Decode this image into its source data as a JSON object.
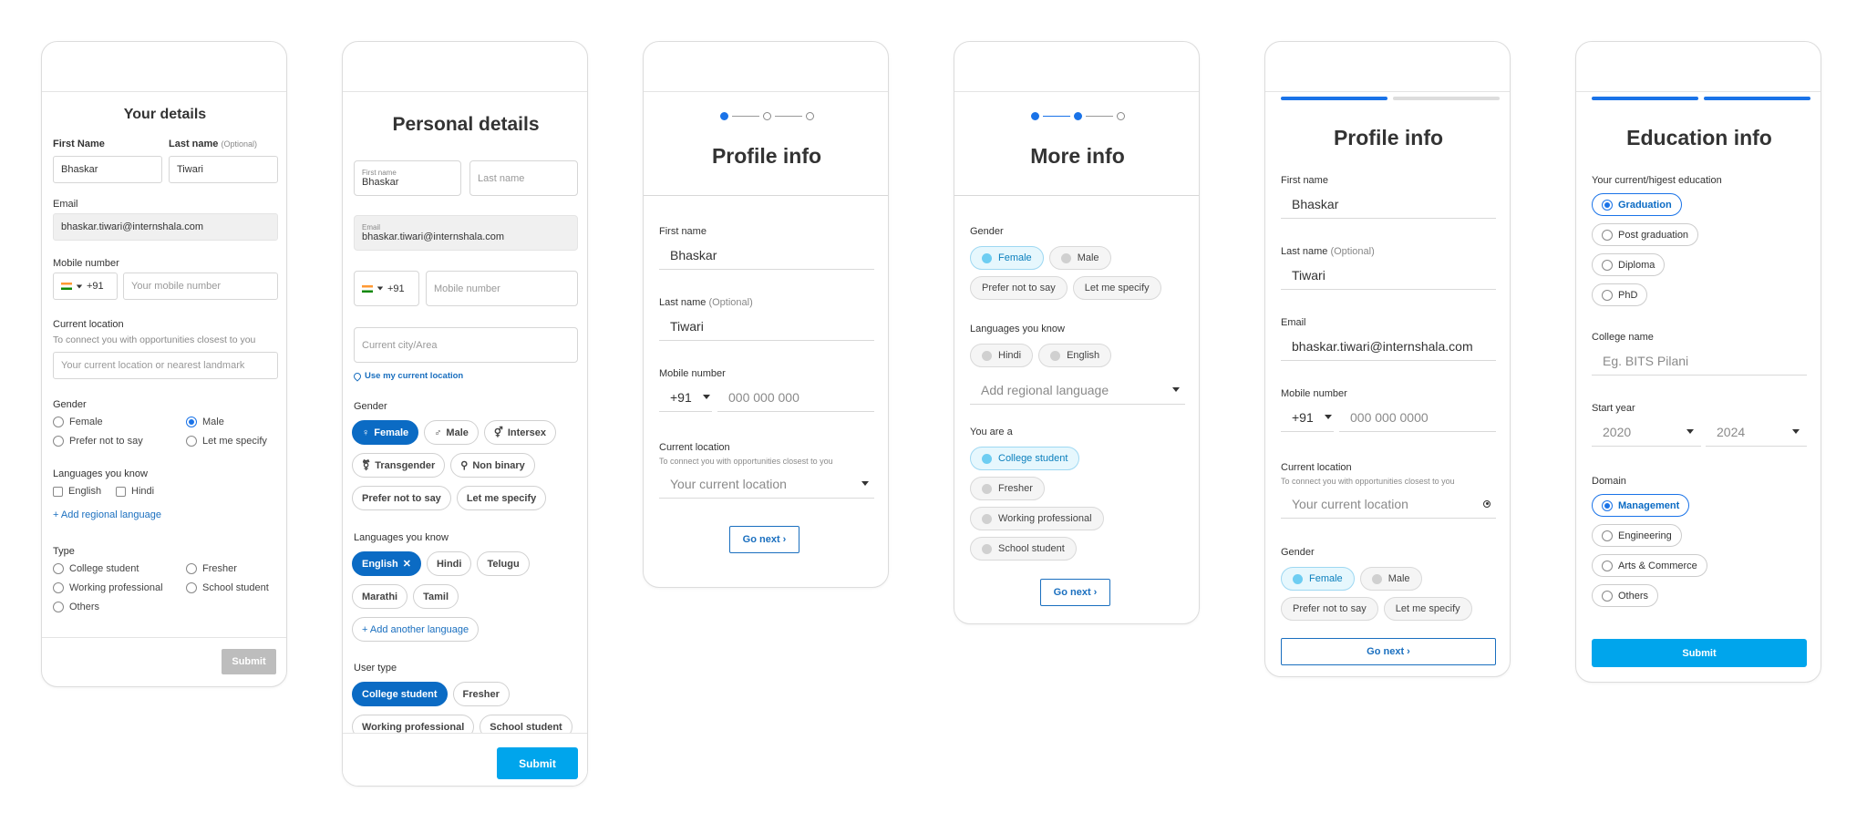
{
  "c1": {
    "title": "Your details",
    "first_label": "First Name",
    "first_val": "Bhaskar",
    "last_label": "Last name",
    "last_opt": "(Optional)",
    "last_val": "Tiwari",
    "email_label": "Email",
    "email_val": "bhaskar.tiwari@internshala.com",
    "mobile_label": "Mobile number",
    "code": "+91",
    "mobile_ph": "Your mobile number",
    "loc_label": "Current location",
    "loc_hint": "To connect you with opportunities closest to you",
    "loc_ph": "Your current location or nearest landmark",
    "gender_label": "Gender",
    "g_female": "Female",
    "g_male": "Male",
    "g_pnts": "Prefer not to say",
    "g_lms": "Let me specify",
    "lang_label": "Languages you know",
    "l_en": "English",
    "l_hi": "Hindi",
    "add_lang": "+ Add regional language",
    "type_label": "Type",
    "t_college": "College student",
    "t_fresher": "Fresher",
    "t_work": "Working professional",
    "t_school": "School student",
    "t_others": "Others",
    "submit": "Submit"
  },
  "c2": {
    "title": "Personal details",
    "first_float": "First name",
    "first_val": "Bhaskar",
    "last_ph": "Last name",
    "email_float": "Email",
    "email_val": "bhaskar.tiwari@internshala.com",
    "code": "+91",
    "mobile_ph": "Mobile number",
    "city_ph": "Current city/Area",
    "use_loc": "Use my current location",
    "gender_label": "Gender",
    "g": [
      "Female",
      "Male",
      "Intersex",
      "Transgender",
      "Non binary",
      "Prefer not to say",
      "Let me specify"
    ],
    "lang_label": "Languages you know",
    "langs": [
      "English",
      "Hindi",
      "Telugu",
      "Marathi",
      "Tamil"
    ],
    "add_lang": "+ Add another language",
    "type_label": "User type",
    "types": [
      "College student",
      "Fresher",
      "Working professional",
      "School student"
    ],
    "submit": "Submit"
  },
  "c3": {
    "title": "Profile info",
    "first_label": "First name",
    "first_val": "Bhaskar",
    "last_label": "Last name",
    "last_opt": "(Optional)",
    "last_val": "Tiwari",
    "mobile_label": "Mobile number",
    "code": "+91",
    "mobile_ph": "000 000 000",
    "loc_label": "Current location",
    "loc_hint": "To connect you with opportunities closest to you",
    "loc_ph": "Your current location",
    "next": "Go next ›"
  },
  "c4": {
    "title": "More info",
    "gender_label": "Gender",
    "g": [
      "Female",
      "Male",
      "Prefer not to say",
      "Let me specify"
    ],
    "lang_label": "Languages you know",
    "langs": [
      "Hindi",
      "English"
    ],
    "add_lang": "Add regional language",
    "you_label": "You are a",
    "types": [
      "College student",
      "Fresher",
      "Working professional",
      "School student"
    ],
    "next": "Go next ›"
  },
  "c5": {
    "title": "Profile info",
    "first_label": "First name",
    "first_val": "Bhaskar",
    "last_label": "Last name",
    "last_opt": "(Optional)",
    "last_val": "Tiwari",
    "email_label": "Email",
    "email_val": "bhaskar.tiwari@internshala.com",
    "mobile_label": "Mobile number",
    "code": "+91",
    "mobile_ph": "000 000 0000",
    "loc_label": "Current location",
    "loc_hint": "To connect you with opportunities closest to you",
    "loc_ph": "Your current location",
    "gender_label": "Gender",
    "g": [
      "Female",
      "Male",
      "Prefer not to say",
      "Let me specify"
    ],
    "next": "Go next ›"
  },
  "c6": {
    "title": "Education info",
    "edu_label": "Your current/higest education",
    "edu": [
      "Graduation",
      "Post graduation",
      "Diploma",
      "PhD"
    ],
    "college_label": "College name",
    "college_ph": "Eg. BITS Pilani",
    "start_label": "Start year",
    "start": "2020",
    "end": "2024",
    "domain_label": "Domain",
    "domains": [
      "Management",
      "Engineering",
      "Arts & Commerce",
      "Others"
    ],
    "submit": "Submit"
  },
  "colors": {
    "primary": "#0b6bc4",
    "accent": "#00a5ec",
    "link": "#1a6fbf"
  }
}
